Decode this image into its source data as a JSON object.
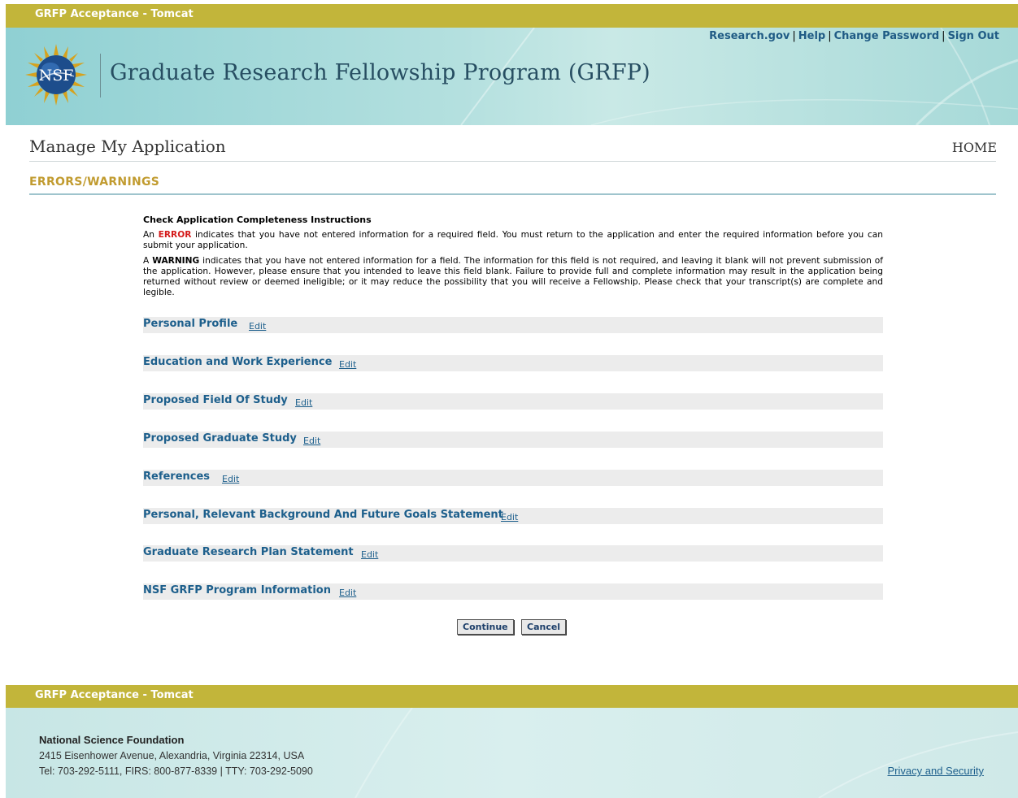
{
  "env_label": "GRFP Acceptance - Tomcat",
  "header": {
    "title": "Graduate Research Fellowship Program (GRFP)",
    "logo_text": "NSF",
    "nav": [
      "Research.gov",
      "Help",
      "Change Password",
      "Sign Out"
    ]
  },
  "page": {
    "title": "Manage My Application",
    "home_link": "HOME",
    "section_heading": "ERRORS/WARNINGS"
  },
  "instructions": {
    "title": "Check Application Completeness Instructions",
    "error_prefix": "An ",
    "error_word": "ERROR",
    "error_text": " indicates that you have not entered information for a required field. You must return to the application and enter the required information before you can submit your application.",
    "warning_prefix": "A ",
    "warning_word": "WARNING",
    "warning_text": " indicates that you have not entered information for a field. The information for this field is not required, and leaving it blank will not prevent submission of the application. However, please ensure that you intended to leave this field blank. Failure to provide full and complete information may result in the application being returned without review or deemed ineligible; or it may reduce the possibility that you will receive a Fellowship. Please check that your transcript(s) are complete and legible."
  },
  "sections": [
    {
      "label": "Personal Profile",
      "edit": "Edit"
    },
    {
      "label": "Education and Work Experience",
      "edit": "Edit"
    },
    {
      "label": "Proposed Field Of Study",
      "edit": "Edit"
    },
    {
      "label": "Proposed Graduate Study",
      "edit": "Edit"
    },
    {
      "label": "References",
      "edit": "Edit"
    },
    {
      "label": "Personal, Relevant Background And Future Goals Statement",
      "edit": "Edit"
    },
    {
      "label": "Graduate Research Plan Statement",
      "edit": "Edit"
    },
    {
      "label": "NSF GRFP Program Information",
      "edit": "Edit"
    }
  ],
  "buttons": {
    "continue": "Continue",
    "cancel": "Cancel"
  },
  "footer": {
    "org": "National Science Foundation",
    "address": "2415 Eisenhower Avenue, Alexandria, Virginia 22314, USA",
    "contact": "Tel: 703-292-5111, FIRS: 800-877-8339 | TTY: 703-292-5090",
    "privacy_link": "Privacy and Security"
  },
  "colors": {
    "env_bar": "#c2b53a",
    "section_label": "#1d5f8c",
    "heading_gold": "#c19b2f",
    "error_red": "#d41a1a"
  }
}
